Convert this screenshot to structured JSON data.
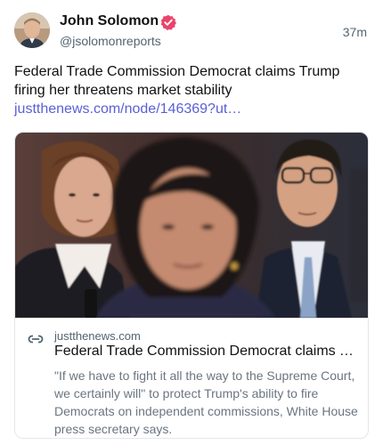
{
  "author": {
    "name": "John Solomon",
    "handle": "@jsolomonreports",
    "time": "37m",
    "verified": true
  },
  "post": {
    "text": "Federal Trade Commission Democrat claims Trump firing her threatens market stability ",
    "link_text": "justthenews.com/node/146369?ut…"
  },
  "link_card": {
    "domain": "justthenews.com",
    "title": "Federal Trade Commission Democrat claims Trump firing her threatens market stability",
    "description": "\"If we have to fight it all the way to the Supreme Court, we certainly will\" to protect Trump's ability to fire Democrats on independent commissions, White House press secretary says."
  },
  "colors": {
    "link": "#5a5fd6",
    "verified_badge": "#e8446c",
    "muted_text": "#536471"
  },
  "icons": {
    "verified": "verified-badge-icon",
    "link": "link-icon"
  }
}
